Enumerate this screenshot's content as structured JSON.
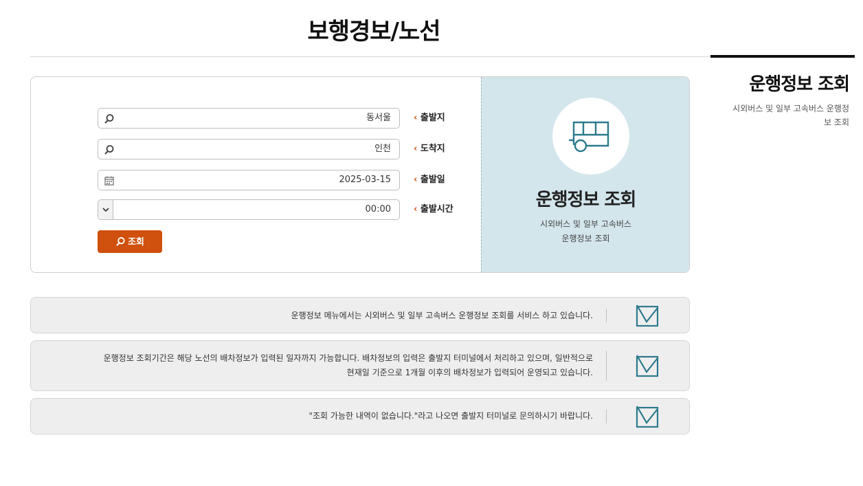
{
  "page": {
    "title": "보행경보/노선"
  },
  "side": {
    "title": "운행정보 조회",
    "desc_line1": "시외버스 및 일부 고속버스 운행정",
    "desc_line2": "보 조회"
  },
  "form": {
    "fields": [
      {
        "label": "출발지",
        "value": "동서울",
        "icon": "search-icon"
      },
      {
        "label": "도착지",
        "value": "인천",
        "icon": "search-icon"
      },
      {
        "label": "출발일",
        "value": "2025-03-15",
        "icon": "calendar-icon"
      },
      {
        "label": "출발시간",
        "value": "00:00",
        "icon": "chevron-down-icon"
      }
    ],
    "search_button": "조회"
  },
  "hero": {
    "title": "운행정보 조회",
    "desc_line1": "시외버스 및 일부 고속버스",
    "desc_line2": "운행정보 조회",
    "icon": "bus-icon"
  },
  "notices": [
    {
      "line1": "운행정보 메뉴에서는 시외버스 및 일부 고속버스 운행정보 조회를 서비스 하고 있습니다.",
      "line2": ""
    },
    {
      "line1": "운행정보 조회기간은 해당 노선의 배차정보가 입력된 일자까지 가능합니다. 배차정보의 입력은 출발지 터미널에서 처리하고 있으며, 일반적으로",
      "line2": "현재일 기준으로 1개월 이후의 배차정보가 입력되어 운영되고 있습니다."
    },
    {
      "line1": "\"조회 가능한 내역이 없습니다.\"라고 나오면 출발지 터미널로 문의하시기 바랍니다.",
      "line2": ""
    }
  ],
  "colors": {
    "accent": "#d0500e",
    "hero_bg": "#d3e6ec",
    "icon": "#2b7a8c"
  }
}
